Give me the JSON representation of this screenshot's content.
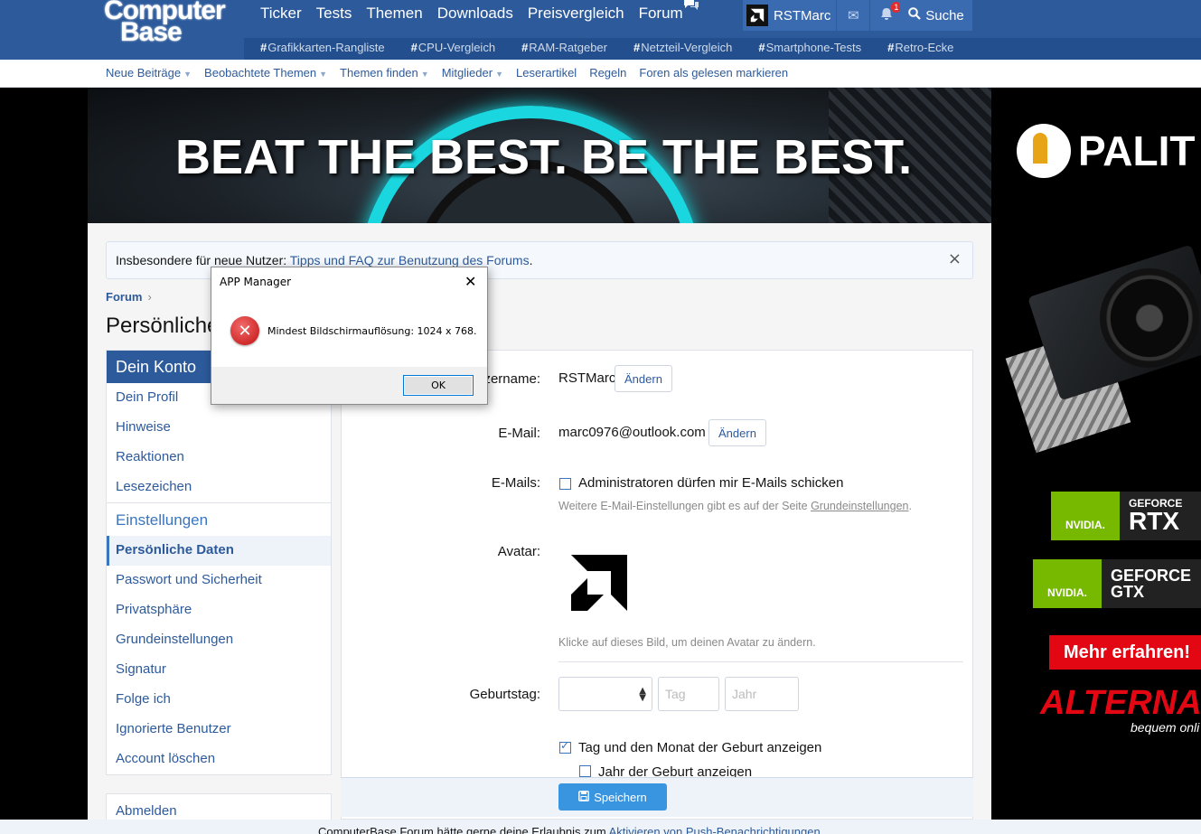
{
  "site": {
    "logo_line1": "Computer",
    "logo_line2": "Base",
    "main_nav": [
      "Ticker",
      "Tests",
      "Themen",
      "Downloads",
      "Preisvergleich",
      "Forum"
    ],
    "user_name": "RSTMarc",
    "notification_count": "1",
    "search_label": "Suche",
    "sub_nav": [
      "Grafikkarten-Rangliste",
      "CPU-Vergleich",
      "RAM-Ratgeber",
      "Netzteil-Vergleich",
      "Smartphone-Tests",
      "Retro-Ecke"
    ],
    "hash": "#"
  },
  "forum_nav": [
    {
      "label": "Neue Beiträge",
      "caret": true
    },
    {
      "label": "Beobachtete Themen",
      "caret": true
    },
    {
      "label": "Themen finden",
      "caret": true
    },
    {
      "label": "Mitglieder",
      "caret": true
    },
    {
      "label": "Leserartikel",
      "caret": false
    },
    {
      "label": "Regeln",
      "caret": false
    },
    {
      "label": "Foren als gelesen markieren",
      "caret": false
    }
  ],
  "banner": {
    "slogan": "BEAT THE BEST. BE THE BEST."
  },
  "ad": {
    "brand": "PALIT",
    "nvidia": "NVIDIA.",
    "geforce": "GEFORCE",
    "rtx": "RTX",
    "gtx": "GTX",
    "cta": "Mehr erfahren!",
    "retailer": "ALTERNATE",
    "tagline": "bequem onli"
  },
  "notice": {
    "prefix": "Insbesondere für neue Nutzer: ",
    "link": "Tipps und FAQ zur Benutzung des Forums",
    "suffix": ".",
    "close": "×"
  },
  "breadcrumb": {
    "item": "Forum",
    "sep": "›"
  },
  "page_title": "Persönliche Daten",
  "sidebar": {
    "heading": "Dein Konto",
    "items": [
      "Dein Profil",
      "Hinweise",
      "Reaktionen",
      "Lesezeichen"
    ],
    "section": "Einstellungen",
    "settings": [
      "Persönliche Daten",
      "Passwort und Sicherheit",
      "Privatsphäre",
      "Grundeinstellungen",
      "Signatur",
      "Folge ich",
      "Ignorierte Benutzer",
      "Account löschen"
    ],
    "selected_index": 0,
    "logout": "Abmelden"
  },
  "form": {
    "username_label": "Benutzername:",
    "username_value": "RSTMarc",
    "change_label": "Ändern",
    "email_label": "E-Mail:",
    "email_value": "marc0976@outlook.com",
    "emails_label": "E-Mails:",
    "emails_opt": "Administratoren dürfen mir E-Mails schicken",
    "emails_checked": false,
    "emails_hint_prefix": "Weitere E-Mail-Einstellungen gibt es auf der Seite ",
    "emails_hint_link": "Grundeinstellungen",
    "emails_hint_suffix": ".",
    "avatar_label": "Avatar:",
    "avatar_hint": "Klicke auf dieses Bild, um deinen Avatar zu ändern.",
    "birthday_label": "Geburtstag:",
    "day_placeholder": "Tag",
    "year_placeholder": "Jahr",
    "show_day_month": "Tag und den Monat der Geburt anzeigen",
    "show_day_month_checked": true,
    "show_year": "Jahr der Geburt anzeigen",
    "show_year_checked": false,
    "save_label": "Speichern"
  },
  "bottom_bar": {
    "prefix": "ComputerBase Forum hätte gerne deine Erlaubnis zum ",
    "link": "Aktivieren von Push-Benachrichtigungen"
  },
  "dialog": {
    "title": "APP Manager",
    "close": "✕",
    "message": "Mindest Bildschirmauflösung: 1024 x 768.",
    "ok_label": "OK"
  }
}
